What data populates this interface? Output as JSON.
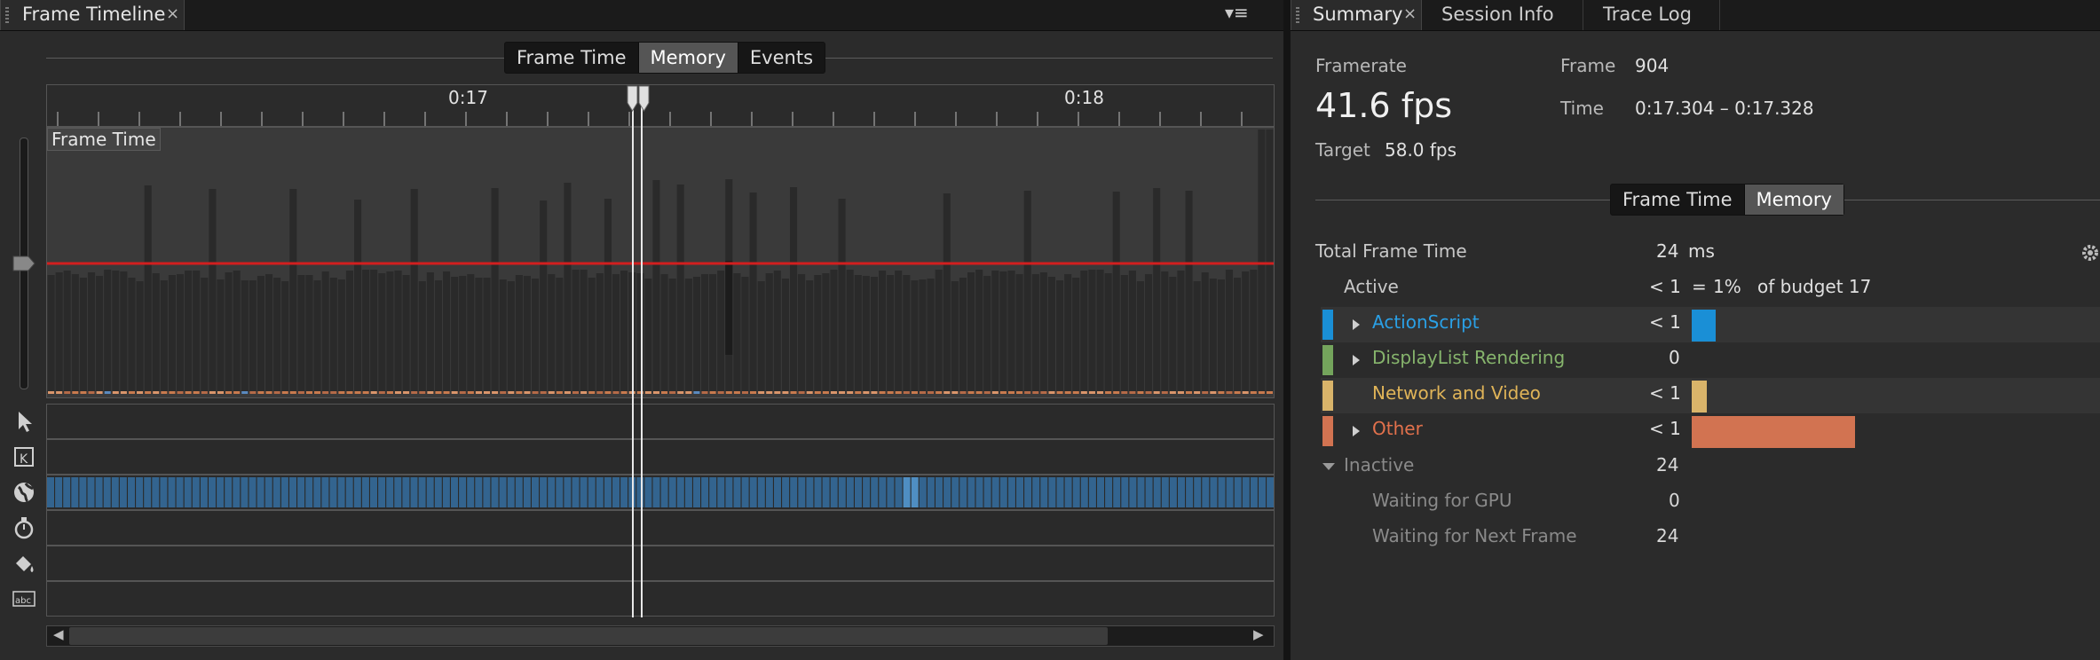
{
  "left_panel": {
    "tab_title": "Frame Timeline",
    "tab_close": "×",
    "menu_glyph": "▾≡",
    "segmented": [
      {
        "label": "Frame Time",
        "selected": false
      },
      {
        "label": "Memory",
        "selected": true
      },
      {
        "label": "Events",
        "selected": false
      }
    ],
    "ruler_labels": [
      "0:17",
      "0:18"
    ],
    "track_label": "Frame Time",
    "scroll_left": "◀",
    "scroll_right": "▶",
    "tools": [
      "select-icon",
      "keyframe-icon",
      "globe-icon",
      "stopwatch-icon",
      "paint-bucket-icon",
      "text-abc-icon"
    ]
  },
  "right_panel": {
    "tabs": [
      {
        "label": "Summary",
        "active": true
      },
      {
        "label": "Session Info",
        "active": false
      },
      {
        "label": "Trace Log",
        "active": false
      }
    ],
    "tab_close": "×",
    "framerate_label": "Framerate",
    "framerate_value": "41.6 fps",
    "target_label": "Target",
    "target_value": "58.0 fps",
    "frame_label": "Frame",
    "frame_value": "904",
    "time_label": "Time",
    "time_value": "0:17.304 – 0:17.328",
    "segmented": [
      {
        "label": "Frame Time",
        "selected": false
      },
      {
        "label": "Memory",
        "selected": true
      }
    ],
    "total_label": "Total Frame Time",
    "total_value": "24",
    "total_unit": "ms",
    "active_label": "Active",
    "active_value": "< 1",
    "active_eq": "=",
    "active_pct": "1%",
    "active_budget": "of budget 17",
    "categories": [
      {
        "name": "ActionScript",
        "value": "< 1",
        "color": "#1a8fd6",
        "text_color": "#2aa0e6",
        "expandable": true,
        "bar_fraction": 0.059
      },
      {
        "name": "DisplayList Rendering",
        "value": "0",
        "color": "#74a45c",
        "text_color": "#86b46c",
        "expandable": true,
        "bar_fraction": 0
      },
      {
        "name": "Network and Video",
        "value": "< 1",
        "color": "#d9b46a",
        "text_color": "#e0b458",
        "expandable": false,
        "bar_fraction": 0.036
      },
      {
        "name": "Other",
        "value": "< 1",
        "color": "#d27351",
        "text_color": "#e2714c",
        "expandable": true,
        "bar_fraction": 0.4
      }
    ],
    "inactive_label": "Inactive",
    "inactive_value": "24",
    "waiting_gpu_label": "Waiting for GPU",
    "waiting_gpu_value": "0",
    "waiting_frame_label": "Waiting for Next Frame",
    "waiting_frame_value": "24"
  }
}
